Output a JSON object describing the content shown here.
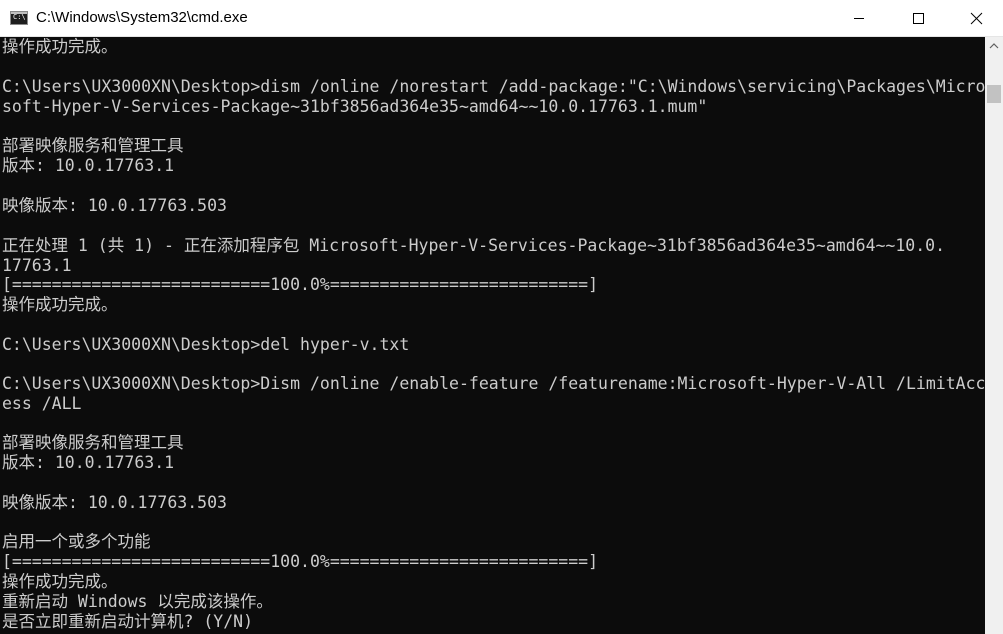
{
  "window": {
    "title": "C:\\Windows\\System32\\cmd.exe",
    "icon_glyph": "C:\\",
    "buttons": {
      "minimize": "minimize-icon",
      "maximize": "maximize-icon",
      "close": "close-icon"
    }
  },
  "console": {
    "background": "#0c0c0c",
    "foreground": "#cccccc",
    "lines": [
      "操作成功完成。",
      "",
      "C:\\Users\\UX3000XN\\Desktop>dism /online /norestart /add-package:\"C:\\Windows\\servicing\\Packages\\Micro",
      "soft-Hyper-V-Services-Package~31bf3856ad364e35~amd64~~10.0.17763.1.mum\"",
      "",
      "部署映像服务和管理工具",
      "版本: 10.0.17763.1",
      "",
      "映像版本: 10.0.17763.503",
      "",
      "正在处理 1 (共 1) - 正在添加程序包 Microsoft-Hyper-V-Services-Package~31bf3856ad364e35~amd64~~10.0.",
      "17763.1",
      "[==========================100.0%==========================]",
      "操作成功完成。",
      "",
      "C:\\Users\\UX3000XN\\Desktop>del hyper-v.txt",
      "",
      "C:\\Users\\UX3000XN\\Desktop>Dism /online /enable-feature /featurename:Microsoft-Hyper-V-All /LimitAcc",
      "ess /ALL",
      "",
      "部署映像服务和管理工具",
      "版本: 10.0.17763.1",
      "",
      "映像版本: 10.0.17763.503",
      "",
      "启用一个或多个功能",
      "[==========================100.0%==========================]",
      "操作成功完成。",
      "重新启动 Windows 以完成该操作。",
      "是否立即重新启动计算机? (Y/N)"
    ]
  }
}
